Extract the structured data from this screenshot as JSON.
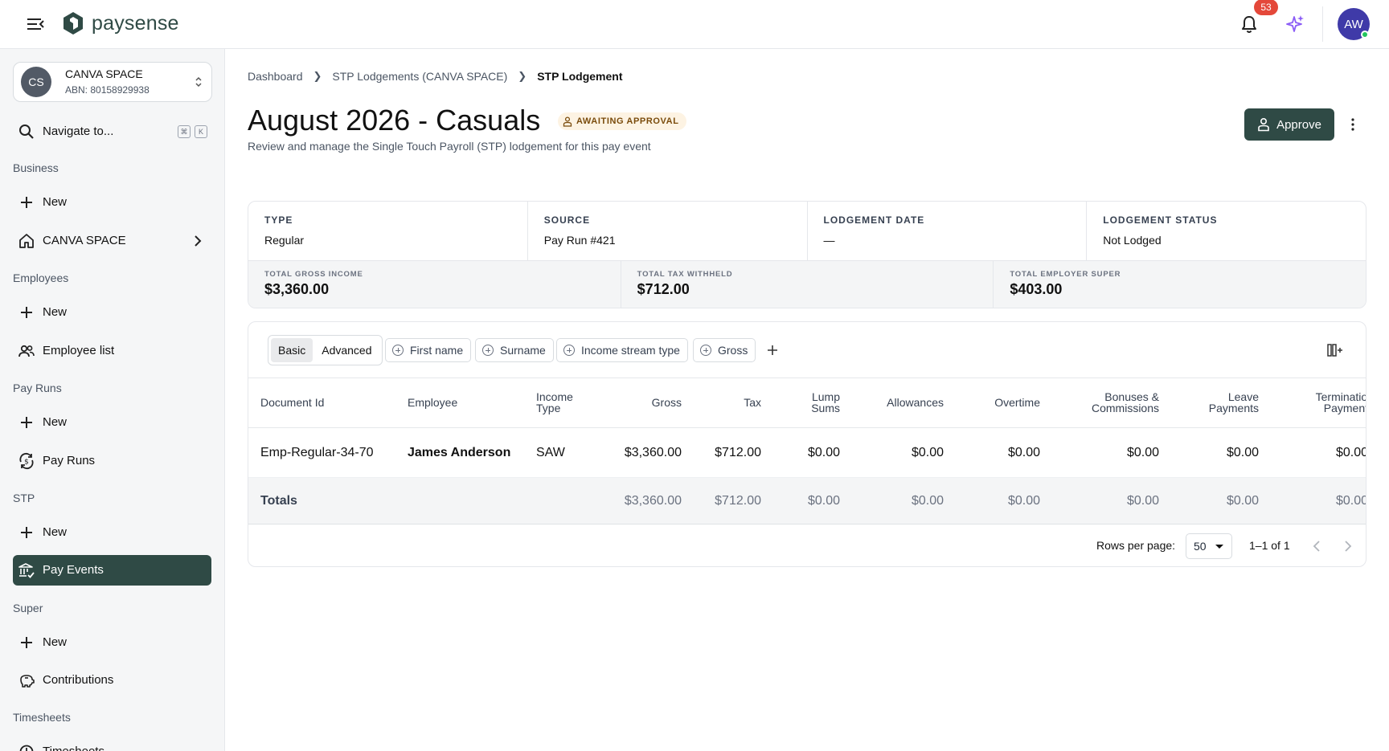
{
  "app": {
    "brand": "paysense",
    "notification_count": "53",
    "user_initials": "AW"
  },
  "sidebar": {
    "org": {
      "initials": "CS",
      "name": "CANVA SPACE",
      "abn": "ABN: 80158929938"
    },
    "navigate": {
      "label": "Navigate to...",
      "key1": "⌘",
      "key2": "K"
    },
    "sections": {
      "business": "Business",
      "employees": "Employees",
      "pay_runs": "Pay Runs",
      "stp": "STP",
      "super": "Super",
      "timesheets": "Timesheets"
    },
    "items": {
      "business_new": "New",
      "canva_space": "CANVA SPACE",
      "employees_new": "New",
      "employee_list": "Employee list",
      "payruns_new": "New",
      "pay_runs": "Pay Runs",
      "stp_new": "New",
      "pay_events": "Pay Events",
      "super_new": "New",
      "contributions": "Contributions",
      "timesheets": "Timesheets"
    }
  },
  "breadcrumb": [
    "Dashboard",
    "STP Lodgements (CANVA SPACE)",
    "STP Lodgement"
  ],
  "page": {
    "title": "August 2026 - Casuals",
    "status": "AWAITING APPROVAL",
    "subtitle": "Review and manage the Single Touch Payroll (STP) lodgement for this pay event",
    "approve_label": "Approve"
  },
  "summary": {
    "fields": [
      {
        "label": "TYPE",
        "value": "Regular"
      },
      {
        "label": "SOURCE",
        "value": "Pay Run #421"
      },
      {
        "label": "LODGEMENT DATE",
        "value": "—"
      },
      {
        "label": "LODGEMENT STATUS",
        "value": "Not Lodged"
      }
    ],
    "totals": [
      {
        "label": "TOTAL GROSS INCOME",
        "value": "$3,360.00"
      },
      {
        "label": "TOTAL TAX WITHHELD",
        "value": "$712.00"
      },
      {
        "label": "TOTAL EMPLOYER SUPER",
        "value": "$403.00"
      }
    ]
  },
  "table": {
    "view_modes": [
      "Basic",
      "Advanced"
    ],
    "filters": [
      "First name",
      "Surname",
      "Income stream type",
      "Gross"
    ],
    "headers": {
      "doc_id": "Document Id",
      "employee": "Employee",
      "income_type_1": "Income",
      "income_type_2": "Type",
      "gross": "Gross",
      "tax": "Tax",
      "lump_1": "Lump",
      "lump_2": "Sums",
      "allowances": "Allowances",
      "overtime": "Overtime",
      "bonus_1": "Bonuses &",
      "bonus_2": "Commissions",
      "leave_1": "Leave",
      "leave_2": "Payments",
      "term_1": "Termination",
      "term_2": "Payments"
    },
    "rows": [
      {
        "doc_id": "Emp-Regular-34-70",
        "employee": "James Anderson",
        "income_type": "SAW",
        "gross": "$3,360.00",
        "tax": "$712.00",
        "lump": "$0.00",
        "allowances": "$0.00",
        "overtime": "$0.00",
        "bonus": "$0.00",
        "leave": "$0.00",
        "term": "$0.00"
      }
    ],
    "totals": {
      "label": "Totals",
      "gross": "$3,360.00",
      "tax": "$712.00",
      "lump": "$0.00",
      "allowances": "$0.00",
      "overtime": "$0.00",
      "bonus": "$0.00",
      "leave": "$0.00",
      "term": "$0.00"
    },
    "pagination": {
      "rows_label": "Rows per page:",
      "rows_value": "50",
      "range": "1–1 of 1"
    }
  },
  "colors": {
    "primary": "#2f4a45",
    "badge": "#e4483a",
    "avatar": "#3f3aa8",
    "sparkle": "#8b5cf6"
  }
}
